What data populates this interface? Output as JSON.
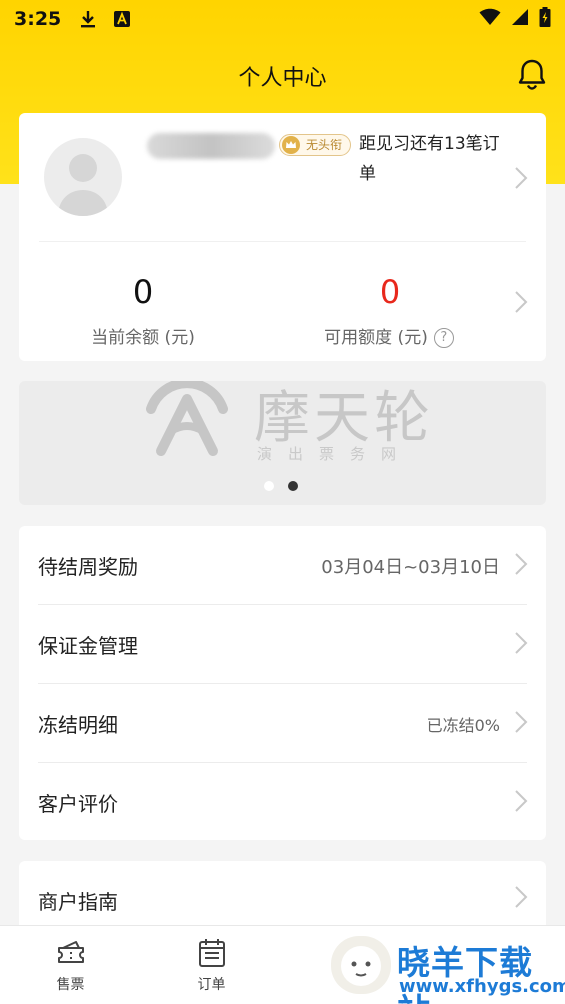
{
  "status_bar": {
    "time": "3:25"
  },
  "header": {
    "title": "个人中心"
  },
  "profile": {
    "badge": "无头衔",
    "promo_text": "距见习还有13笔订单"
  },
  "stats": {
    "balance_value": "0",
    "balance_label": "当前余额 (元)",
    "credit_value": "0",
    "credit_label": "可用额度 (元)",
    "help_symbol": "?"
  },
  "banner": {
    "title": "摩天轮",
    "subtitle": "演出票务网"
  },
  "menu": [
    {
      "label": "待结周奖励",
      "value": "03月04日~03月10日"
    },
    {
      "label": "保证金管理",
      "value": ""
    },
    {
      "label": "冻结明细",
      "value": "已冻结0%"
    },
    {
      "label": "客户评价",
      "value": ""
    }
  ],
  "menu2": [
    {
      "label": "商户指南"
    }
  ],
  "tabs": [
    {
      "label": "售票",
      "icon": "ticket-icon"
    },
    {
      "label": "订单",
      "icon": "calendar-icon"
    }
  ],
  "watermark": {
    "title": "晓羊下载站",
    "url": "www.xfhygs.com"
  },
  "colors": {
    "accent_yellow": "#ffd400",
    "credit_red": "#e8281c",
    "watermark_blue": "#1d7bd6"
  }
}
